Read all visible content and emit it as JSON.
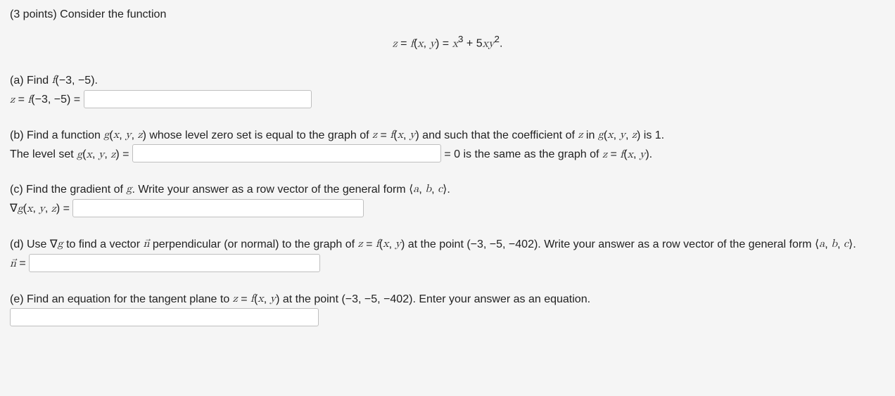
{
  "intro": "(3 points) Consider the function",
  "equation_html": "<span class='math'>z</span> <span class='rm'>=</span> <span class='math'>f</span><span class='rm'>(</span><span class='math'>x</span><span class='rm'>,</span> <span class='math'>y</span><span class='rm'>)</span> <span class='rm'>=</span> <span class='math'>x</span><sup class='rm'>3</sup> <span class='rm'>+ 5</span><span class='math'>xy</span><sup class='rm'>2</sup><span class='rm'>.</span>",
  "a": {
    "prompt_html": "(a) Find <span class='math'>f</span><span class='rm'>(−3, −5)</span>.",
    "lhs_html": "<span class='math'>z</span> <span class='rm'>=</span> <span class='math'>f</span><span class='rm'>(−3, −5) =</span>"
  },
  "b": {
    "prompt_html": "(b) Find a function <span class='math'>g</span><span class='rm'>(</span><span class='math'>x</span><span class='rm'>,</span> <span class='math'>y</span><span class='rm'>,</span> <span class='math'>z</span><span class='rm'>)</span> whose level zero set is equal to the graph of <span class='math'>z</span> <span class='rm'>=</span> <span class='math'>f</span><span class='rm'>(</span><span class='math'>x</span><span class='rm'>,</span> <span class='math'>y</span><span class='rm'>)</span> and such that the coefficient of <span class='math'>z</span> in <span class='math'>g</span><span class='rm'>(</span><span class='math'>x</span><span class='rm'>,</span> <span class='math'>y</span><span class='rm'>,</span> <span class='math'>z</span><span class='rm'>)</span> is <span class='rm'>1</span>.",
    "lhs_html": "The level set <span class='math'>g</span><span class='rm'>(</span><span class='math'>x</span><span class='rm'>,</span> <span class='math'>y</span><span class='rm'>,</span> <span class='math'>z</span><span class='rm'>) =</span>",
    "rhs_html": "<span class='rm'>= 0</span> is the same as the graph of <span class='math'>z</span> <span class='rm'>=</span> <span class='math'>f</span><span class='rm'>(</span><span class='math'>x</span><span class='rm'>,</span> <span class='math'>y</span><span class='rm'>)</span>."
  },
  "c": {
    "prompt_html": "(c) Find the gradient of <span class='math'>g</span>. Write your answer as a row vector of the general form <span class='rm'>⟨</span><span class='math'>a</span><span class='rm'>,</span> <span class='math'>b</span><span class='rm'>,</span> <span class='math'>c</span><span class='rm'>⟩</span>.",
    "lhs_html": "<span class='rm'>∇</span><span class='math'>g</span><span class='rm'>(</span><span class='math'>x</span><span class='rm'>,</span> <span class='math'>y</span><span class='rm'>,</span> <span class='math'>z</span><span class='rm'>) =</span>"
  },
  "d": {
    "prompt_html": "(d) Use <span class='rm'>∇</span><span class='math'>g</span> to find a vector <span class='math'>n&#8407;</span> perpendicular (or normal) to the graph of <span class='math'>z</span> <span class='rm'>=</span> <span class='math'>f</span><span class='rm'>(</span><span class='math'>x</span><span class='rm'>,</span> <span class='math'>y</span><span class='rm'>)</span> at the point <span class='rm'>(−3, −5, −402)</span>. Write your answer as a row vector of the general form <span class='rm'>⟨</span><span class='math'>a</span><span class='rm'>,</span> <span class='math'>b</span><span class='rm'>,</span> <span class='math'>c</span><span class='rm'>⟩</span>.",
    "lhs_html": "<span class='math'>n&#8407;</span> <span class='rm'>=</span>"
  },
  "e": {
    "prompt_html": "(e) Find an equation for the tangent plane to <span class='math'>z</span> <span class='rm'>=</span> <span class='math'>f</span><span class='rm'>(</span><span class='math'>x</span><span class='rm'>,</span> <span class='math'>y</span><span class='rm'>)</span> at the point <span class='rm'>(−3, −5, −402)</span>. Enter your answer as an equation."
  }
}
